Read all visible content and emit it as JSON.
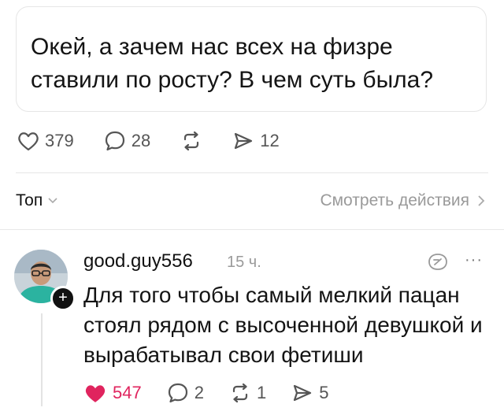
{
  "post": {
    "text": "Окей, а зачем нас всех на физре ставили по росту? В чем суть была?",
    "likes": "379",
    "comments": "28",
    "shares": "12"
  },
  "thread": {
    "sort_label": "Топ",
    "view_actions_label": "Смотреть действия"
  },
  "comment": {
    "username": "good.guy556",
    "time": "15 ч.",
    "more": "···",
    "text": "Для того чтобы самый мелкий пацан стоял рядом с высоченной девушкой и вырабатывал свои фетиши",
    "likes": "547",
    "replies": "2",
    "reposts": "1",
    "shares": "5",
    "liked": true
  },
  "colors": {
    "like_active": "#e0245e",
    "muted": "#9a9a9a",
    "text": "#141414"
  }
}
